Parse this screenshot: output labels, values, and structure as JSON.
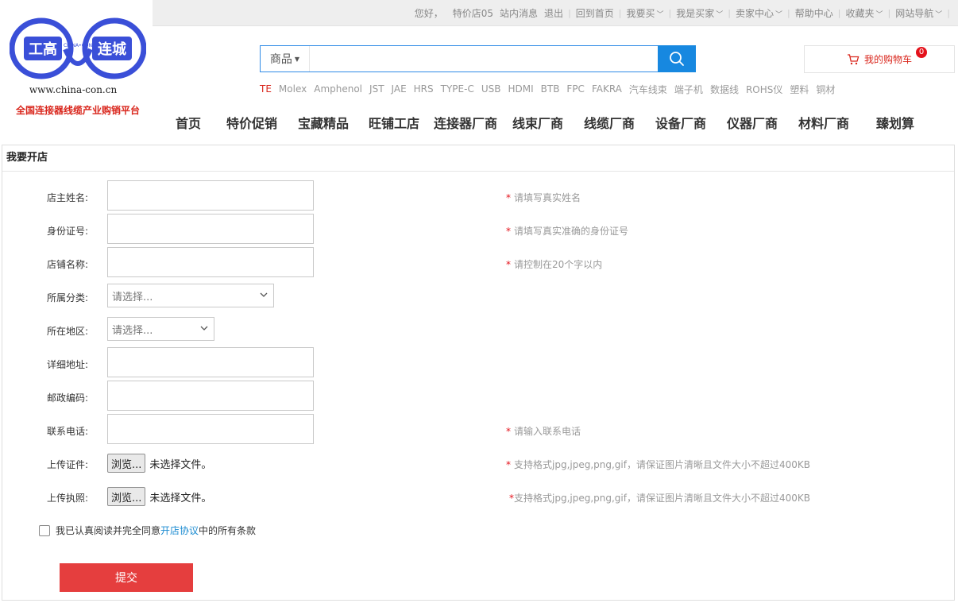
{
  "topbar": {
    "greeting": "您好，",
    "username": "特价店05",
    "messages": "站内消息",
    "logout": "退出",
    "home": "回到首页",
    "buy": "我要买",
    "buyer": "我是买家",
    "seller": "卖家中心",
    "help": "帮助中心",
    "favorites": "收藏夹",
    "sitemap": "网站导航"
  },
  "logo": {
    "left_text": "工高",
    "center_text": "CHINA•CON",
    "right_text": "连城",
    "url": "www.china-con.cn",
    "slogan": "全国连接器线缆产业购销平台",
    "brand_color": "#3a4fd8"
  },
  "search": {
    "type_label": "商品",
    "placeholder": "",
    "button_icon": "search-icon"
  },
  "cart": {
    "label": "我的购物车",
    "count": "0",
    "icon": "cart-icon"
  },
  "hotwords": [
    "TE",
    "Molex",
    "Amphenol",
    "JST",
    "JAE",
    "HRS",
    "TYPE-C",
    "USB",
    "HDMI",
    "BTB",
    "FPC",
    "FAKRA",
    "汽车线束",
    "端子机",
    "数据线",
    "ROHS仪",
    "塑料",
    "铜材"
  ],
  "nav": [
    "首页",
    "特价促销",
    "宝藏精品",
    "旺铺工店",
    "连接器厂商",
    "线束厂商",
    "线缆厂商",
    "设备厂商",
    "仪器厂商",
    "材料厂商",
    "臻划算"
  ],
  "form": {
    "title": "我要开店",
    "owner_name": {
      "label": "店主姓名:",
      "required_mark": "*",
      "hint": "请填写真实姓名"
    },
    "id_number": {
      "label": "身份证号:",
      "required_mark": "*",
      "hint": "请填写真实准确的身份证号"
    },
    "shop_name": {
      "label": "店铺名称:",
      "required_mark": "*",
      "hint": "请控制在20个字以内"
    },
    "category": {
      "label": "所属分类:",
      "value": "请选择..."
    },
    "region": {
      "label": "所在地区:",
      "value": "请选择..."
    },
    "address": {
      "label": "详细地址:"
    },
    "zip": {
      "label": "邮政编码:"
    },
    "phone": {
      "label": "联系电话:",
      "required_mark": "*",
      "hint": "请输入联系电话"
    },
    "id_upload": {
      "label": "上传证件:",
      "button": "浏览...",
      "status": "未选择文件。",
      "required_mark": "*",
      "hint": "支持格式jpg,jpeg,png,gif，请保证图片清晰且文件大小不超过400KB"
    },
    "license_upload": {
      "label": "上传执照:",
      "button": "浏览...",
      "status": "未选择文件。",
      "required_mark": "*",
      "hint": "支持格式jpg,jpeg,png,gif，请保证图片清晰且文件大小不超过400KB"
    },
    "agreement": {
      "prefix": "我已认真阅读并完全同意",
      "link": "开店协议",
      "suffix": "中的所有条款",
      "checked": false
    },
    "submit": "提交"
  },
  "colors": {
    "accent_blue": "#1788e0",
    "required_red": "#e4121b",
    "submit_red": "#e53e3e",
    "link_blue": "#1a8bd1"
  }
}
